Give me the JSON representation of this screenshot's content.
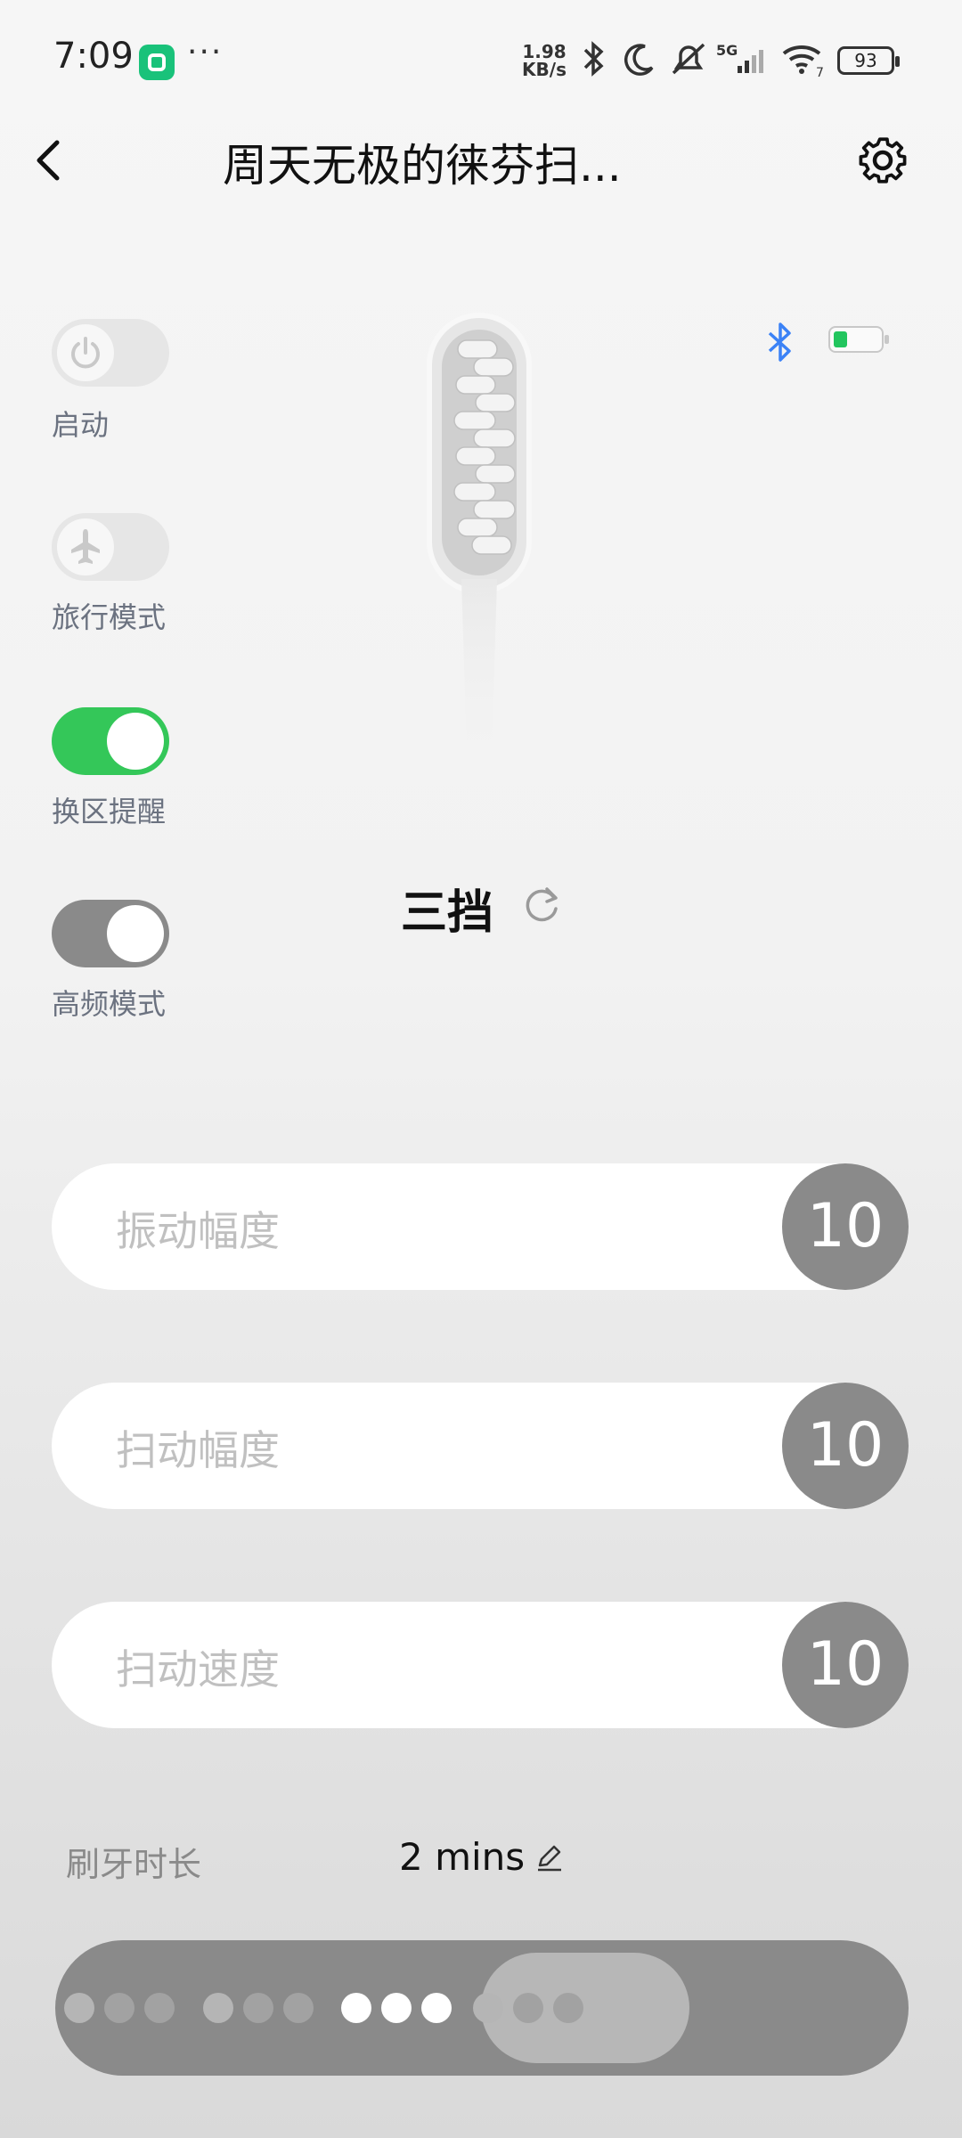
{
  "status_bar": {
    "time": "7:09",
    "dots": "···",
    "net_speed_value": "1.98",
    "net_speed_unit": "KB/s",
    "battery": "93"
  },
  "header": {
    "title": "周天无极的徕芬扫..."
  },
  "toggles": [
    {
      "label": "启动",
      "state": "off",
      "icon": "power-icon"
    },
    {
      "label": "旅行模式",
      "state": "off",
      "icon": "airplane-icon"
    },
    {
      "label": "换区提醒",
      "state": "on"
    },
    {
      "label": "高频模式",
      "state": "on"
    }
  ],
  "device": {
    "battery_level": 0.3,
    "battery_color": "#22c55e",
    "bluetooth_color": "#3b82f6",
    "mode_label": "三挡"
  },
  "sliders": [
    {
      "label": "振动幅度",
      "value": "10"
    },
    {
      "label": "扫动幅度",
      "value": "10"
    },
    {
      "label": "扫动速度",
      "value": "10"
    }
  ],
  "duration": {
    "label": "刷牙时长",
    "value": "2 mins"
  },
  "dot_selector": {
    "groups": [
      3,
      3,
      3,
      3
    ],
    "selected_group": 2
  },
  "colors": {
    "toggle_on": "#34c759",
    "accent_gray": "#8a8a8a"
  }
}
